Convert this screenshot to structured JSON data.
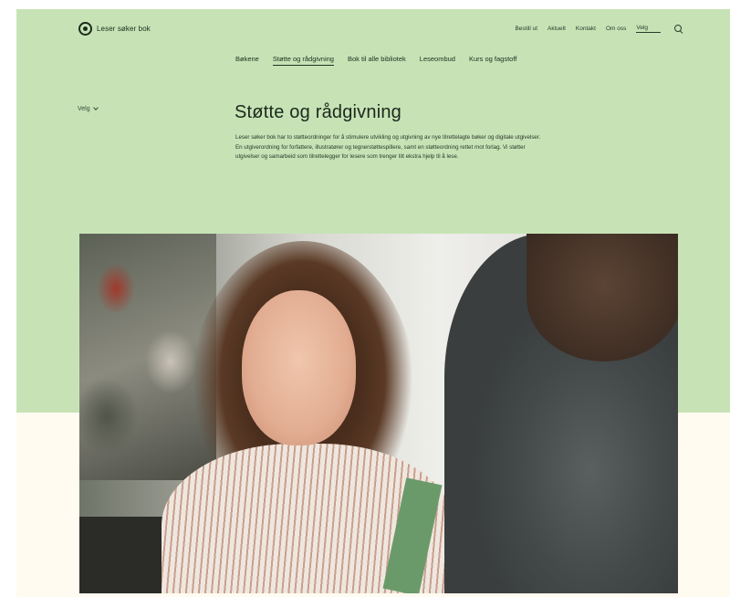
{
  "header": {
    "logo_text": "Leser søker bok",
    "util_links": [
      "Bestill ut",
      "Aktuelt",
      "Kontakt",
      "Om oss"
    ],
    "language": "Velg",
    "search_icon": "search-icon"
  },
  "main_nav": {
    "items": [
      {
        "label": "Bøkene",
        "active": false
      },
      {
        "label": "Støtte og rådgivning",
        "active": true
      },
      {
        "label": "Bok til alle bibliotek",
        "active": false
      },
      {
        "label": "Leseombud",
        "active": false
      },
      {
        "label": "Kurs og fagstoff",
        "active": false
      }
    ]
  },
  "side": {
    "select_label": "Velg"
  },
  "page": {
    "title": "Støtte og rådgivning",
    "intro": "Leser søker bok har to støtteordninger for å stimulere utvikling og utgivning av nye tilrettelagte bøker og digitale utgivelser. En utgiverordning for forfattere, illustratører og tegnerstøttespillere, samt en støtteordning rettet mot forlag. Vi støtter utgivelser og samarbeid som tilrettelegger for lesere som trenger litt ekstra hjelp til å lese."
  },
  "hero": {
    "alt": ""
  },
  "colors": {
    "band": "#c7e3b6",
    "page_bg": "#fffbf0",
    "text": "#1f2a1f"
  }
}
